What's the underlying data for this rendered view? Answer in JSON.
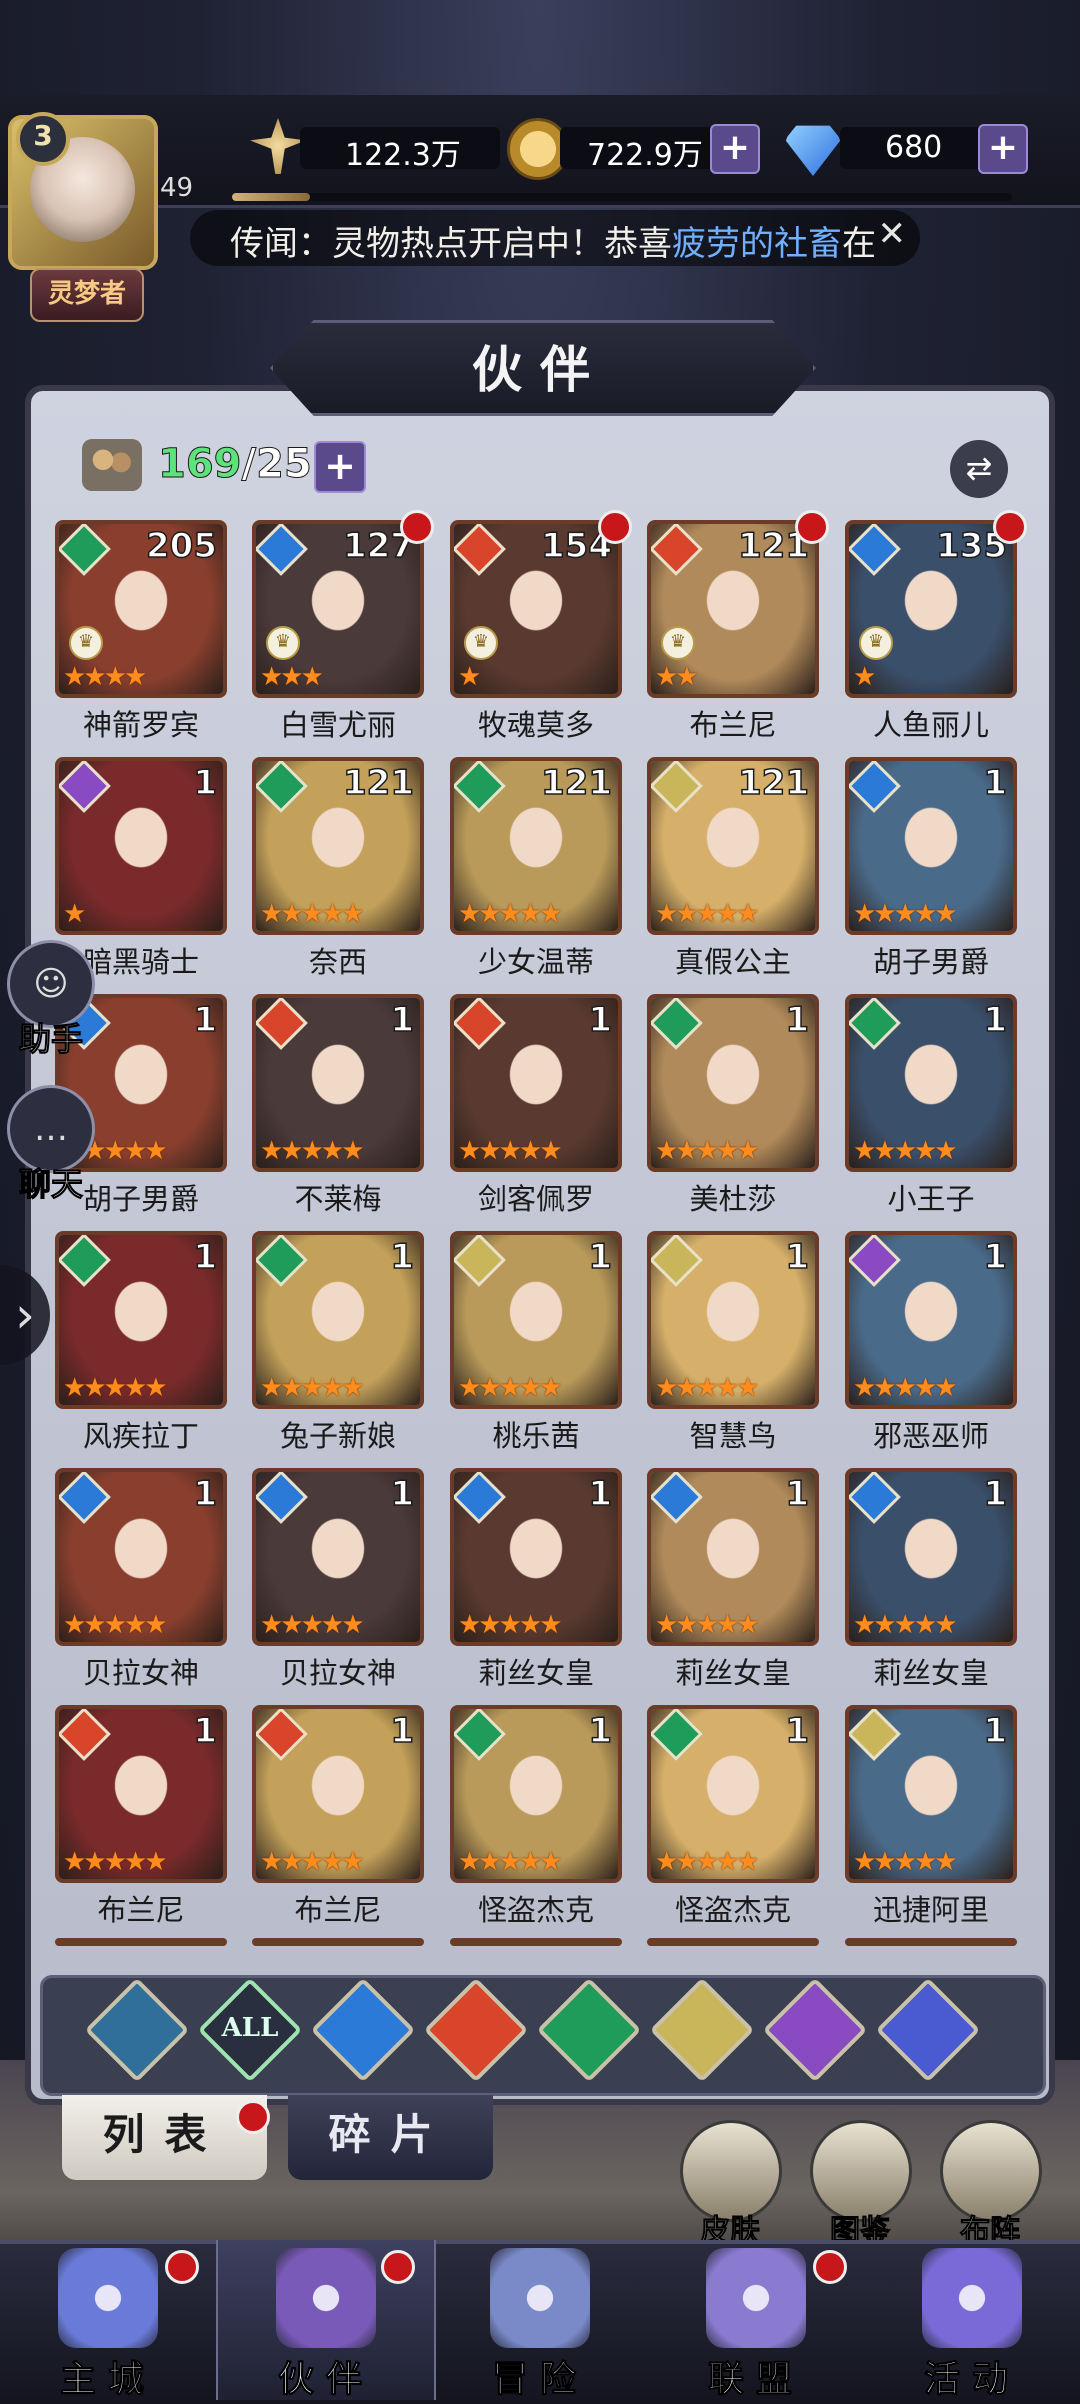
{
  "player": {
    "vip_level": "3",
    "level": "49",
    "title": "灵梦者",
    "xp_fraction": 0.1
  },
  "resources": {
    "power": "122.3万",
    "gold": "722.9万",
    "diamond": "680"
  },
  "news": {
    "prefix": "传闻：灵物热点开启中！恭喜",
    "highlight": "疲劳的社畜",
    "suffix": "在"
  },
  "panel": {
    "title": "伙伴",
    "count_current": "169",
    "count_max": "/255"
  },
  "element_colors": {
    "wind": "#1f9b5a",
    "water": "#2b7ad8",
    "fire": "#d8452a",
    "light": "#c9b65a",
    "dark": "#8a4ac2"
  },
  "cards": [
    {
      "name": "神箭罗宾",
      "element": "wind",
      "level": "205",
      "stars": 4,
      "crown": true,
      "dot": false
    },
    {
      "name": "白雪尤丽",
      "element": "water",
      "level": "127",
      "stars": 3,
      "crown": true,
      "dot": true
    },
    {
      "name": "牧魂莫多",
      "element": "fire",
      "level": "154",
      "stars": 1,
      "crown": true,
      "dot": true
    },
    {
      "name": "布兰尼",
      "element": "fire",
      "level": "121",
      "stars": 2,
      "crown": true,
      "dot": true
    },
    {
      "name": "人鱼丽儿",
      "element": "water",
      "level": "135",
      "stars": 1,
      "crown": true,
      "dot": true
    },
    {
      "name": "暗黑骑士",
      "element": "dark",
      "level": "1",
      "stars": 1,
      "crown": false,
      "dot": false
    },
    {
      "name": "奈西",
      "element": "wind",
      "level": "121",
      "stars": 5,
      "crown": false,
      "dot": false
    },
    {
      "name": "少女温蒂",
      "element": "wind",
      "level": "121",
      "stars": 5,
      "crown": false,
      "dot": false
    },
    {
      "name": "真假公主",
      "element": "light",
      "level": "121",
      "stars": 5,
      "crown": false,
      "dot": false
    },
    {
      "name": "胡子男爵",
      "element": "water",
      "level": "1",
      "stars": 5,
      "crown": false,
      "dot": false
    },
    {
      "name": "胡子男爵",
      "element": "water",
      "level": "1",
      "stars": 5,
      "crown": false,
      "dot": false
    },
    {
      "name": "不莱梅",
      "element": "fire",
      "level": "1",
      "stars": 5,
      "crown": false,
      "dot": false
    },
    {
      "name": "剑客佩罗",
      "element": "fire",
      "level": "1",
      "stars": 5,
      "crown": false,
      "dot": false
    },
    {
      "name": "美杜莎",
      "element": "wind",
      "level": "1",
      "stars": 5,
      "crown": false,
      "dot": false
    },
    {
      "name": "小王子",
      "element": "wind",
      "level": "1",
      "stars": 5,
      "crown": false,
      "dot": false
    },
    {
      "name": "风疾拉丁",
      "element": "wind",
      "level": "1",
      "stars": 5,
      "crown": false,
      "dot": false
    },
    {
      "name": "兔子新娘",
      "element": "wind",
      "level": "1",
      "stars": 5,
      "crown": false,
      "dot": false
    },
    {
      "name": "桃乐茜",
      "element": "light",
      "level": "1",
      "stars": 5,
      "crown": false,
      "dot": false
    },
    {
      "name": "智慧鸟",
      "element": "light",
      "level": "1",
      "stars": 5,
      "crown": false,
      "dot": false
    },
    {
      "name": "邪恶巫师",
      "element": "dark",
      "level": "1",
      "stars": 5,
      "crown": false,
      "dot": false
    },
    {
      "name": "贝拉女神",
      "element": "water",
      "level": "1",
      "stars": 5,
      "crown": false,
      "dot": false
    },
    {
      "name": "贝拉女神",
      "element": "water",
      "level": "1",
      "stars": 5,
      "crown": false,
      "dot": false
    },
    {
      "name": "莉丝女皇",
      "element": "water",
      "level": "1",
      "stars": 5,
      "crown": false,
      "dot": false
    },
    {
      "name": "莉丝女皇",
      "element": "water",
      "level": "1",
      "stars": 5,
      "crown": false,
      "dot": false
    },
    {
      "name": "莉丝女皇",
      "element": "water",
      "level": "1",
      "stars": 5,
      "crown": false,
      "dot": false
    },
    {
      "name": "布兰尼",
      "element": "fire",
      "level": "1",
      "stars": 5,
      "crown": false,
      "dot": false
    },
    {
      "name": "布兰尼",
      "element": "fire",
      "level": "1",
      "stars": 5,
      "crown": false,
      "dot": false
    },
    {
      "name": "怪盗杰克",
      "element": "wind",
      "level": "1",
      "stars": 5,
      "crown": false,
      "dot": false
    },
    {
      "name": "怪盗杰克",
      "element": "wind",
      "level": "1",
      "stars": 5,
      "crown": false,
      "dot": false
    },
    {
      "name": "迅捷阿里",
      "element": "light",
      "level": "1",
      "stars": 5,
      "crown": false,
      "dot": false
    }
  ],
  "side": {
    "assistant": "助手",
    "chat": "聊天"
  },
  "filters": [
    {
      "icon": "all-elements-icon",
      "label": ""
    },
    {
      "icon": "all-icon",
      "label": "ALL"
    },
    {
      "icon": "water-icon",
      "label": ""
    },
    {
      "icon": "fire-icon",
      "label": ""
    },
    {
      "icon": "wind-icon",
      "label": ""
    },
    {
      "icon": "light-icon",
      "label": ""
    },
    {
      "icon": "dark-icon",
      "label": ""
    },
    {
      "icon": "planet-icon",
      "label": ""
    }
  ],
  "tabs": {
    "list": "列表",
    "shards": "碎片"
  },
  "quick": {
    "skin": "皮肤",
    "codex": "图鉴",
    "formation": "布阵"
  },
  "nav": [
    {
      "label": "主城",
      "icon": "castle-icon",
      "dot": true
    },
    {
      "label": "伙伴",
      "icon": "witch-hat-icon",
      "dot": true
    },
    {
      "label": "冒险",
      "icon": "compass-icon",
      "dot": false
    },
    {
      "label": "联盟",
      "icon": "shield-icon",
      "dot": true
    },
    {
      "label": "活动",
      "icon": "cards-icon",
      "dot": false
    }
  ]
}
